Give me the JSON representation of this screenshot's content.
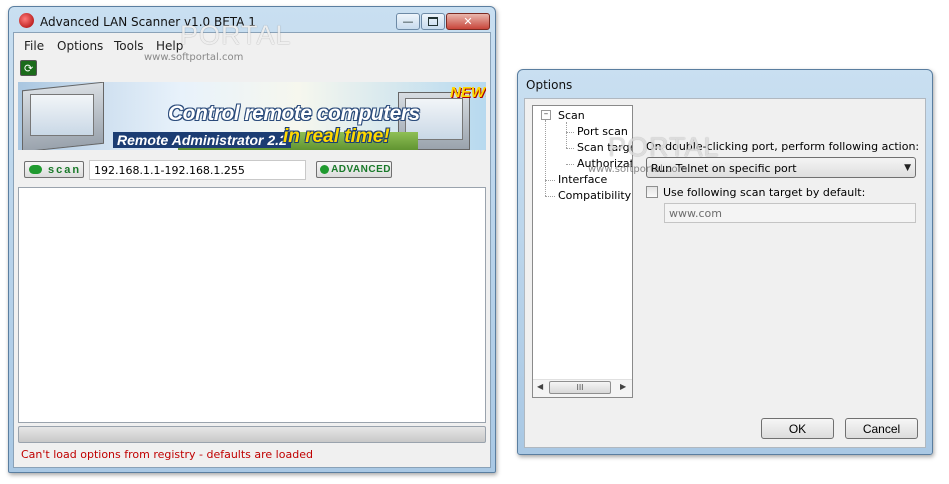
{
  "scanner": {
    "title": "Advanced LAN Scanner v1.0 BETA 1",
    "menu": [
      "File",
      "Options",
      "Tools",
      "Help"
    ],
    "scan_label": "scan",
    "ip_range": "192.168.1.1-192.168.1.255",
    "advanced_label": "ADVANCED",
    "status_text": "Can't load options from registry - defaults are loaded",
    "banner": {
      "headline": "Control remote computers",
      "subline": "in real time!",
      "product": "Remote Administrator 2.2",
      "badge": "NEW!"
    }
  },
  "options": {
    "title": "Options",
    "tree": {
      "root": "Scan",
      "children": [
        "Port scan",
        "Scan target",
        "Authorization"
      ],
      "siblings": [
        "Interface",
        "Compatibility"
      ]
    },
    "port_action_label": "On double-clicking port, perform following action:",
    "port_action_value": "Run Telnet on specific port",
    "use_target_label": "Use following scan target by default:",
    "target_placeholder": "www.com",
    "scroll_thumb": "III",
    "ok_label": "OK",
    "cancel_label": "Cancel"
  },
  "watermark": {
    "brand": "PORTAL",
    "url": "www.softportal.com"
  }
}
